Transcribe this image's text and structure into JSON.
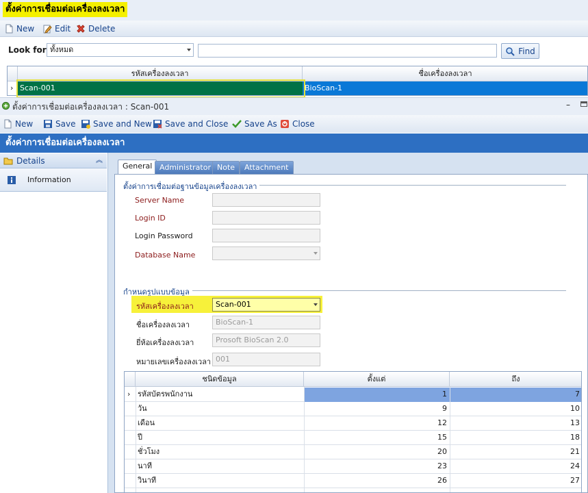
{
  "window": {
    "title": "ตั้งค่าการเชื่อมต่อเครื่องลงเวลา"
  },
  "list_toolbar": {
    "new": "New",
    "edit": "Edit",
    "delete": "Delete"
  },
  "lookfor": {
    "label": "Look for",
    "scope": "ทั้งหมด",
    "query": "",
    "find": "Find"
  },
  "top_grid": {
    "headers": [
      "รหัสเครื่องลงเวลา",
      "ชื่อเครื่องลงเวลา"
    ],
    "rows": [
      {
        "code": "Scan-001",
        "name": "BioScan-1"
      }
    ]
  },
  "detail": {
    "title": "ตั้งค่าการเชื่อมต่อเครื่องลงเวลา : Scan-001",
    "toolbar": {
      "new": "New",
      "save": "Save",
      "save_new": "Save and New",
      "save_close": "Save and Close",
      "save_as": "Save As",
      "close": "Close"
    },
    "header": "ตั้งค่าการเชื่อมต่อเครื่องลงเวลา",
    "nav": {
      "details": "Details",
      "information": "Information"
    },
    "tabs": [
      "General",
      "Administrator",
      "Note",
      "Attachment"
    ],
    "db_section": {
      "title": "ตั้งค่าการเชื่อมต่อฐานข้อมูลเครื่องลงเวลา",
      "server_name": "Server Name",
      "login_id": "Login ID",
      "login_password": "Login Password",
      "database_name": "Database Name",
      "server_value": "",
      "login_value": "",
      "password_value": "",
      "database_value": ""
    },
    "format_section": {
      "title": "กำหนดรูปแบบข้อมูล",
      "code_label": "รหัสเครื่องลงเวลา",
      "code_value": "Scan-001",
      "name_label": "ชื่อเครื่องลงเวลา",
      "name_value": "BioScan-1",
      "brand_label": "ยี่ห้อเครื่องลงเวลา",
      "brand_value": "Prosoft BioScan 2.0",
      "number_label": "หมายเลขเครื่องลงเวลา",
      "number_value": "001"
    },
    "grid": {
      "headers": [
        "ชนิดข้อมูล",
        "ตั้งแต่",
        "ถึง"
      ],
      "rows": [
        {
          "type": "รหัสบัตรพนักงาน",
          "from": "1",
          "to": "7"
        },
        {
          "type": "วัน",
          "from": "9",
          "to": "10"
        },
        {
          "type": "เดือน",
          "from": "12",
          "to": "13"
        },
        {
          "type": "ปี",
          "from": "15",
          "to": "18"
        },
        {
          "type": "ชั่วโมง",
          "from": "20",
          "to": "21"
        },
        {
          "type": "นาที",
          "from": "23",
          "to": "24"
        },
        {
          "type": "วินาที",
          "from": "26",
          "to": "27"
        }
      ]
    }
  },
  "colors": {
    "accent_blue": "#2d6fc2",
    "highlight_yellow": "#f4f000",
    "selected_green": "#007246",
    "selected_blue": "#0a78d7"
  }
}
